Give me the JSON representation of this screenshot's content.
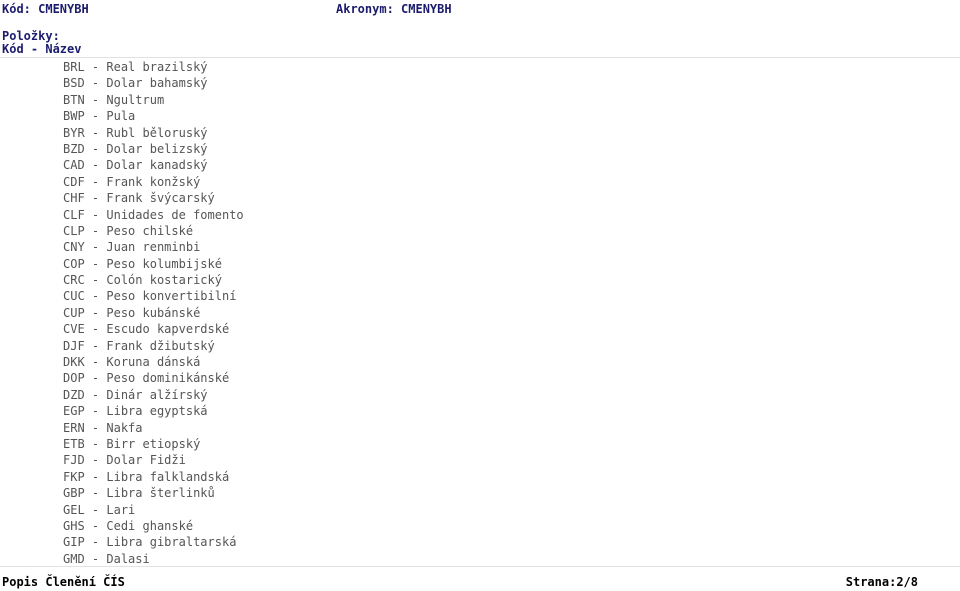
{
  "header": {
    "code_label": "Kód:",
    "code_value": "CMENYBH",
    "code_line": "Kód: CMENYBH",
    "acronym_label": "Akronym:",
    "acronym_value": "CMENYBH",
    "acronym_line": "Akronym: CMENYBH",
    "items_label": "Položky:",
    "columns_line": "Kód - Název",
    "column_code": "Kód",
    "column_separator": "-",
    "column_name": "Název",
    "text_color": "#1c1c6e"
  },
  "rules": {
    "color": "#e2e2e2"
  },
  "list": {
    "separator": "-",
    "text_color": "#555555",
    "items": [
      {
        "code": "BRL",
        "name": "Real brazilský"
      },
      {
        "code": "BSD",
        "name": "Dolar bahamský"
      },
      {
        "code": "BTN",
        "name": "Ngultrum"
      },
      {
        "code": "BWP",
        "name": "Pula"
      },
      {
        "code": "BYR",
        "name": "Rubl běloruský"
      },
      {
        "code": "BZD",
        "name": "Dolar belizský"
      },
      {
        "code": "CAD",
        "name": "Dolar kanadský"
      },
      {
        "code": "CDF",
        "name": "Frank konžský"
      },
      {
        "code": "CHF",
        "name": "Frank švýcarský"
      },
      {
        "code": "CLF",
        "name": "Unidades de fomento"
      },
      {
        "code": "CLP",
        "name": "Peso chilské"
      },
      {
        "code": "CNY",
        "name": "Juan renminbi"
      },
      {
        "code": "COP",
        "name": "Peso kolumbijské"
      },
      {
        "code": "CRC",
        "name": "Colón kostarický"
      },
      {
        "code": "CUC",
        "name": "Peso konvertibilní"
      },
      {
        "code": "CUP",
        "name": "Peso kubánské"
      },
      {
        "code": "CVE",
        "name": "Escudo kapverdské"
      },
      {
        "code": "DJF",
        "name": "Frank džibutský"
      },
      {
        "code": "DKK",
        "name": "Koruna dánská"
      },
      {
        "code": "DOP",
        "name": "Peso dominikánské"
      },
      {
        "code": "DZD",
        "name": "Dinár alžírský"
      },
      {
        "code": "EGP",
        "name": "Libra egyptská"
      },
      {
        "code": "ERN",
        "name": "Nakfa"
      },
      {
        "code": "ETB",
        "name": "Birr etiopský"
      },
      {
        "code": "FJD",
        "name": "Dolar Fidži"
      },
      {
        "code": "FKP",
        "name": "Libra falklandská"
      },
      {
        "code": "GBP",
        "name": "Libra šterlinků"
      },
      {
        "code": "GEL",
        "name": "Lari"
      },
      {
        "code": "GHS",
        "name": "Cedi ghanské"
      },
      {
        "code": "GIP",
        "name": "Libra gibraltarská"
      },
      {
        "code": "GMD",
        "name": "Dalasi"
      }
    ]
  },
  "footer": {
    "title": "Popis Členění ČÍS",
    "page_label": "Strana:2/8",
    "page_current": "2",
    "page_total": "8",
    "text_color": "#000000"
  }
}
